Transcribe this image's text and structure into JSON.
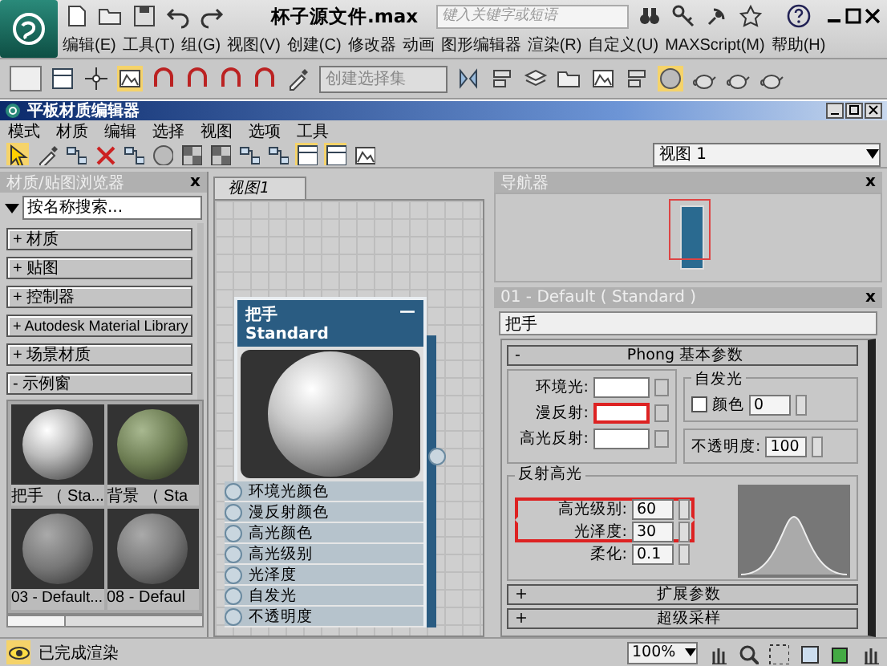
{
  "app": {
    "title": "杯子源文件.max",
    "search": {
      "placeholder": "键入关键字或短语"
    },
    "menu": [
      "编辑(E)",
      "工具(T)",
      "组(G)",
      "视图(V)",
      "创建(C)",
      "修改器",
      "动画",
      "图形编辑器",
      "渲染(R)",
      "自定义(U)",
      "MAXScript(M)",
      "帮助(H)"
    ],
    "selection_set": {
      "placeholder": "创建选择集"
    }
  },
  "editor": {
    "title": "平板材质编辑器",
    "menu": [
      "模式",
      "材质",
      "编辑",
      "选择",
      "视图",
      "选项",
      "工具"
    ],
    "view_dropdown": "视图 1",
    "browser": {
      "title": "材质/贴图浏览器",
      "close": "x",
      "search": {
        "placeholder": "按名称搜索..."
      },
      "groups": [
        {
          "sign": "+",
          "label": "材质"
        },
        {
          "sign": "+",
          "label": "贴图"
        },
        {
          "sign": "+",
          "label": "控制器"
        },
        {
          "sign": "+",
          "label": "Autodesk Material Library"
        },
        {
          "sign": "+",
          "label": "场景材质"
        },
        {
          "sign": "-",
          "label": "示例窗"
        }
      ],
      "swatches": [
        {
          "label": "把手 （ Sta...",
          "kind": "white"
        },
        {
          "label": "背景 （ Sta",
          "kind": "green"
        },
        {
          "label": "03 - Default...",
          "kind": "grey"
        },
        {
          "label": "08 - Defaul",
          "kind": "grey"
        }
      ]
    },
    "view": {
      "tab": "视图1",
      "node": {
        "title": "把手",
        "collapse": "—",
        "subtitle": "Standard",
        "slots": [
          "环境光颜色",
          "漫反射颜色",
          "高光颜色",
          "高光级别",
          "光泽度",
          "自发光",
          "不透明度"
        ]
      }
    },
    "navigator": {
      "title": "导航器",
      "close": "x"
    },
    "params": {
      "title": "01 - Default ( Standard )",
      "close": "x",
      "name": "把手",
      "rollout": {
        "sign": "-",
        "title": "Phong 基本参数"
      },
      "colors": [
        {
          "label": "环境光:",
          "highlighted": false
        },
        {
          "label": "漫反射:",
          "highlighted": true
        },
        {
          "label": "高光反射:",
          "highlighted": false
        }
      ],
      "self_illum": {
        "title": "自发光",
        "checked": false,
        "label": "颜色",
        "value": "0"
      },
      "opacity": {
        "label": "不透明度:",
        "value": "100"
      },
      "specular": {
        "title": "反射高光",
        "fields": [
          {
            "label": "高光级别:",
            "value": "60",
            "highlighted": true
          },
          {
            "label": "光泽度:",
            "value": "30",
            "highlighted": true
          },
          {
            "label": "柔化:",
            "value": "0.1",
            "highlighted": false
          }
        ]
      },
      "rollouts": [
        {
          "sign": "+",
          "title": "扩展参数"
        },
        {
          "sign": "+",
          "title": "超级采样"
        }
      ]
    }
  },
  "status": {
    "text": "已完成渲染",
    "zoom": "100%"
  }
}
